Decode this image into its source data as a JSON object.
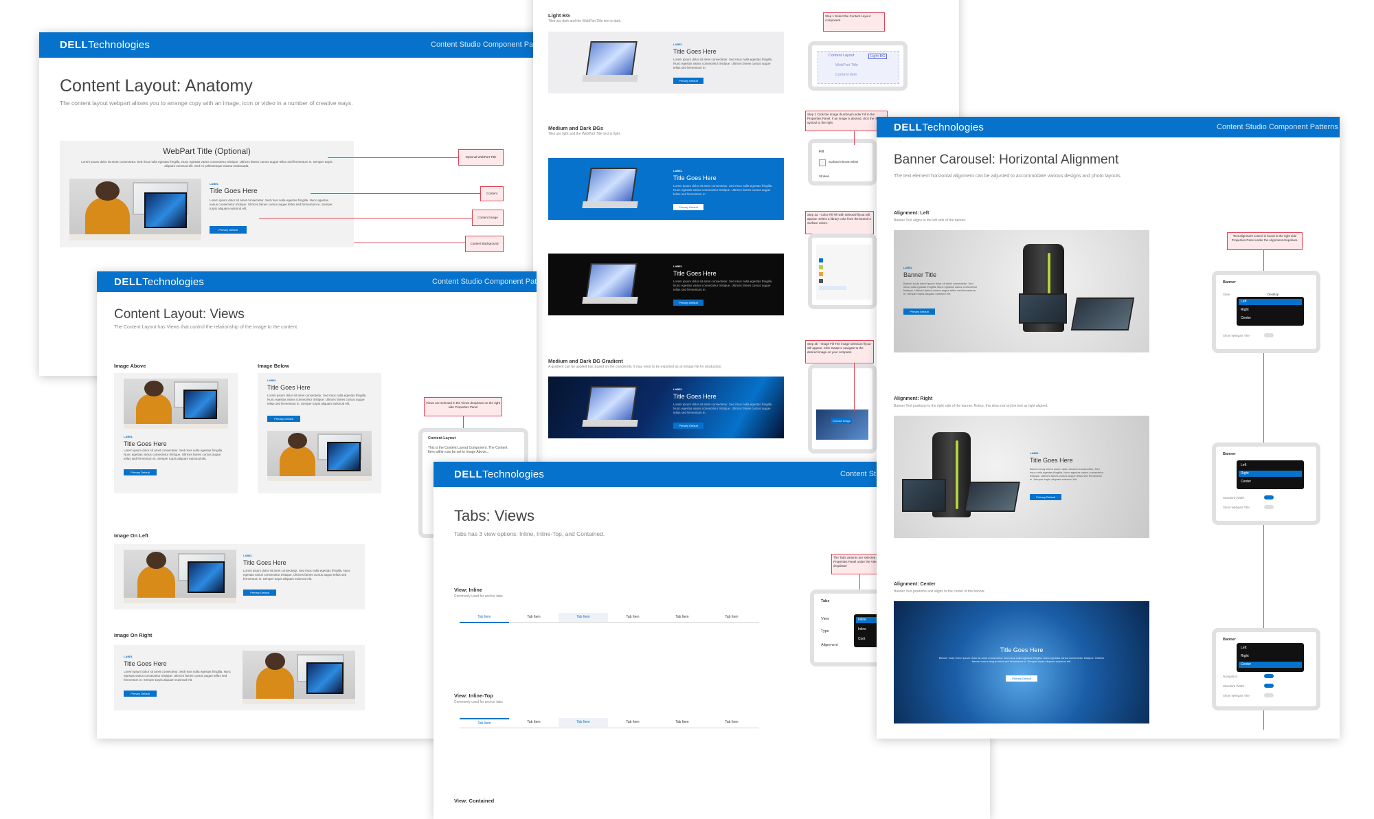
{
  "brand": {
    "logo_bold": "D&#8203;ELL",
    "logo_text": "DELL",
    "logo_rest": "Technologies"
  },
  "header_right": "Content Studio Component Patterns",
  "colors": {
    "dell_blue": "#0672cb",
    "annotation_red": "#e04555"
  },
  "anatomy": {
    "title": "Content Layout: Anatomy",
    "subtitle": "The content layout webpart allows you to arrange copy with an image, icon or video in a number of creative ways.",
    "webpart_title": "WebPart Title (Optional)",
    "intro": "Lorem ipsum dolor sit amet consectetur. Sed risus nulla egestas fringilla. Nunc egestas varius consectetur tristique. Ultrices fames cursus augue tellus sed fermentum in. Semper turpis aliquam euismod elit. Sed mi pellentesque massa malesuada.",
    "label": "LABEL",
    "item_title": "Title Goes Here",
    "body": "Lorem ipsum dolor sit amet consectetur. Sed risus nulla egestas fringilla. Nunc egestas varius consectetur tristique. Ultrices fames cursus augue tellus sed fermentum in. Semper turpis aliquam euismod elit.",
    "button": "Primary Default",
    "annotations": [
      "Optional WebPart Title",
      "Content",
      "Content Image",
      "Content Background"
    ]
  },
  "views": {
    "title": "Content Layout: Views",
    "subtitle": "The Content Layout has Views that control the relationship of the image to the content.",
    "image_above": "Image Above",
    "image_below": "Image Below",
    "image_left": "Image On Left",
    "image_right": "Image On Right",
    "item_title": "Title Goes Here",
    "label": "LABEL",
    "body": "Lorem ipsum dolor sit amet consectetur. Sed risus nulla egestas fringilla. Nunc egestas varius consectetur tristique. Ultrices fames cursus augue tellus sed fermentum in. Semper turpis aliquam euismod elit.",
    "button": "Primary Default",
    "annotation": "Views are selected in the Views dropdown on the right side Properties Panel",
    "panel_title": "Content Layout",
    "panel_text": "This is the Content Layout Component. The Content Item within can be set to Image Above..."
  },
  "backgrounds": {
    "light_label": "Light BG",
    "light_sub": "Tiles are dark and the WebPart Title text is dark.",
    "dark_label": "Medium and Dark BGs",
    "dark_sub": "Tiles are light and the WebPart Title text is light.",
    "gradient_label": "Medium and Dark BG Gradient",
    "gradient_sub": "A gradient can be applied but, based on the complexity, it may need to be exported as an image file for production.",
    "item_title": "Title Goes Here",
    "label": "LABEL",
    "body": "Lorem ipsum dolor sit amet consectetur. Sed risus nulla egestas fringilla. Nunc egestas varius consectetur tristique. Ultrices fames cursus augue tellus sed fermentum in.",
    "button": "Primary Default",
    "step1": "Step 1 Select the Content Layout component",
    "step1_items": [
      "Content Layout",
      "Light BG",
      "WebPart Title",
      "Content Item"
    ],
    "step2": "Step 2 Click the Image thumbnail under Fill in the Properties Panel. If an image is desired, click the mouse symbol to the right.",
    "fill_label": "Fill",
    "fill_value": "Surface/Almost White",
    "strokes": "Strokes",
    "step3a": "Step 3a - Color Fill Fill with selected flyout will appear. Select a library color from the Brand or Surface colors.",
    "step3b": "Step 3b - Image Fill The image selection flyout will appear. Click Swap to navigate to the desired image on your computer.",
    "choose_image": "Choose Image"
  },
  "tabs": {
    "title": "Tabs: Views",
    "subtitle": "Tabs has 3 view options: Inline, Inline-Top, and Contained.",
    "inline_label": "View: Inline",
    "inline_sub": "Commonly used for anchor tabs",
    "inline_top_label": "View: Inline-Top",
    "inline_top_sub": "Commonly used for anchor tabs",
    "contained_label": "View: Contained",
    "tab_items": [
      "Tab Item",
      "Tab Item",
      "Tab Item",
      "Tab Item",
      "Tab Item",
      "Tab Item"
    ],
    "header_right": "Content St",
    "annotation": "The Tabs variants are selected in the Properties Panel under the View dropdown",
    "panel_title": "Tabs",
    "panel_rows": [
      "View",
      "Type",
      "Alignment"
    ],
    "dropdown": [
      "Inline",
      "Inline",
      "Cont"
    ]
  },
  "banner": {
    "title": "Banner Carousel: Horizontal Alignment",
    "subtitle": "The text element horizontal alignment can be adjusted to accommodate various designs and photo layouts.",
    "left_label": "Alignment: Left",
    "left_sub": "Banner Text aligns to the left side of the banner.",
    "right_label": "Alignment: Right",
    "right_sub": "Banner Text positions to the right side of the banner. Notice, this does not set the text as right aligned.",
    "center_label": "Alignment: Center",
    "center_sub": "Banner Text positions and aligns to the center of the banner.",
    "banner_title": "Banner Title",
    "item_title": "Title Goes Here",
    "label": "LABEL",
    "body": "Banner body lorem ipsum dolor sit amet consectetur. Sed risus nulla egestas fringilla. Nunc egestas varius consectetur tristique. Ultrices fames cursus augue tellus sed fermentum in. Semper turpis aliquam euismod elit.",
    "button": "Primary Default",
    "annotation": "Text alignment control is found in the right side Properties Panel under the Alignment dropdown.",
    "panel_title": "Banner",
    "options": [
      "Left",
      "Right",
      "Center"
    ],
    "state": "State",
    "desktop": "Desktop",
    "align": "Alignment",
    "navigation": "Navigation",
    "standard_width": "Standard Width",
    "show_webpart_title": "Show Webpart Title"
  }
}
